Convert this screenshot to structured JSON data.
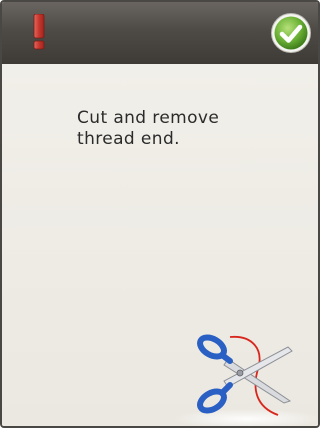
{
  "dialog": {
    "message": "Cut and remove\nthread end."
  },
  "icons": {
    "warning": "exclamation-icon",
    "confirm": "checkmark-icon",
    "illustration": "scissors-icon"
  },
  "colors": {
    "warning": "#c8362d",
    "confirm": "#5aa22a",
    "titlebar": "#4e4a45",
    "background": "#ece9e2",
    "scissors_handle": "#2a5fc4",
    "thread": "#d8261d"
  }
}
